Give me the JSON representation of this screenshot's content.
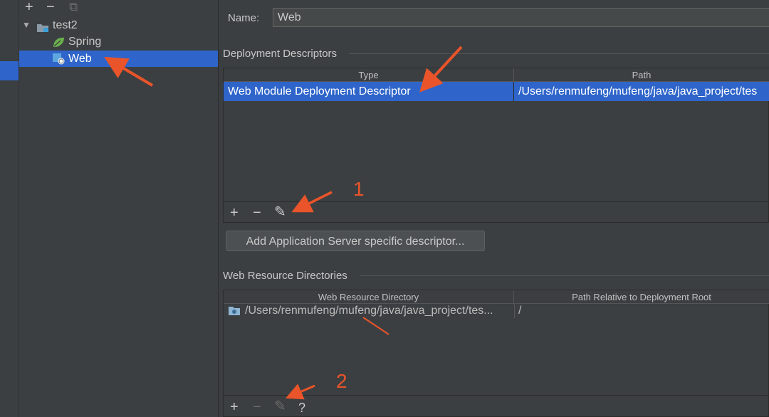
{
  "toolbar": {
    "add_icon": "+",
    "remove_icon": "−",
    "copy_icon": "⧉"
  },
  "tree": {
    "items": [
      {
        "label": "test2",
        "icon": "module-folder-icon",
        "expander": "▼"
      },
      {
        "label": "Spring",
        "icon": "spring-leaf-icon"
      },
      {
        "label": "Web",
        "icon": "web-facet-icon",
        "selected": true
      }
    ]
  },
  "name_field": {
    "label": "Name:",
    "value": "Web"
  },
  "deployment_descriptors": {
    "title": "Deployment Descriptors",
    "columns": [
      "Type",
      "Path"
    ],
    "rows": [
      {
        "type": "Web Module Deployment Descriptor",
        "path": "/Users/renmufeng/mufeng/java/java_project/tes"
      }
    ],
    "toolbar": {
      "add": "+",
      "remove": "−",
      "edit": "✎"
    }
  },
  "add_server_button": "Add Application Server specific descriptor...",
  "web_resource_dirs": {
    "title": "Web Resource Directories",
    "columns": [
      "Web Resource Directory",
      "Path Relative to Deployment Root"
    ],
    "rows": [
      {
        "directory": "/Users/renmufeng/mufeng/java/java_project/tes...",
        "relative": "/"
      }
    ],
    "toolbar": {
      "add": "+",
      "remove": "−",
      "edit": "✎",
      "help": "?"
    }
  },
  "annotations": {
    "one": "1",
    "two": "2",
    "color": "#e9542a"
  },
  "colors": {
    "selection": "#2f65ca",
    "background": "#3c3f41",
    "arrow": "#e9542a"
  }
}
